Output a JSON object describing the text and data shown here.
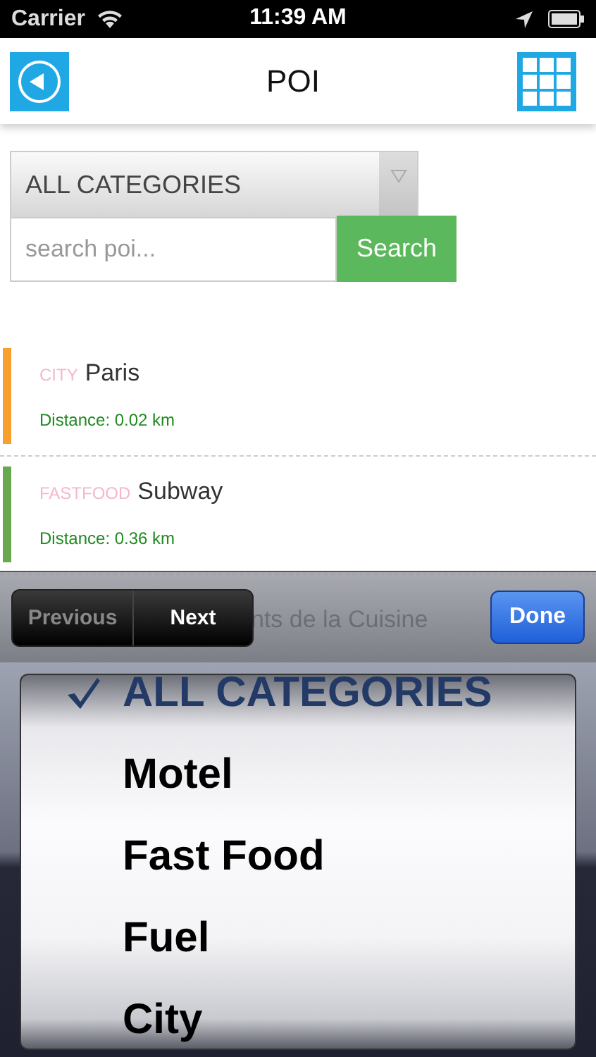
{
  "status_bar": {
    "carrier": "Carrier",
    "time": "11:39 AM"
  },
  "nav": {
    "title": "POI"
  },
  "filter": {
    "category": "ALL CATEGORIES",
    "search": {
      "placeholder": "search poi..."
    },
    "search_button": "Search"
  },
  "pois": [
    {
      "category": "CITY",
      "name": "Paris",
      "distance": "Distance: 0.02 km",
      "color": "#f7a030"
    },
    {
      "category": "FASTFOOD",
      "name": "Subway",
      "distance": "Distance: 0.36 km",
      "color": "#6aa84f"
    },
    {
      "name": "nts de la Cuisine"
    }
  ],
  "toolbar": {
    "buttons": [
      {
        "label": "Previous",
        "disabled": true
      },
      {
        "label": "Next",
        "disabled": false
      }
    ],
    "done": "Done"
  },
  "picker": {
    "options": [
      {
        "label": "ALL CATEGORIES",
        "selected": true
      },
      {
        "label": "Motel",
        "selected": false
      },
      {
        "label": "Fast Food",
        "selected": false
      },
      {
        "label": "Fuel",
        "selected": false
      },
      {
        "label": "City",
        "selected": false
      }
    ]
  }
}
